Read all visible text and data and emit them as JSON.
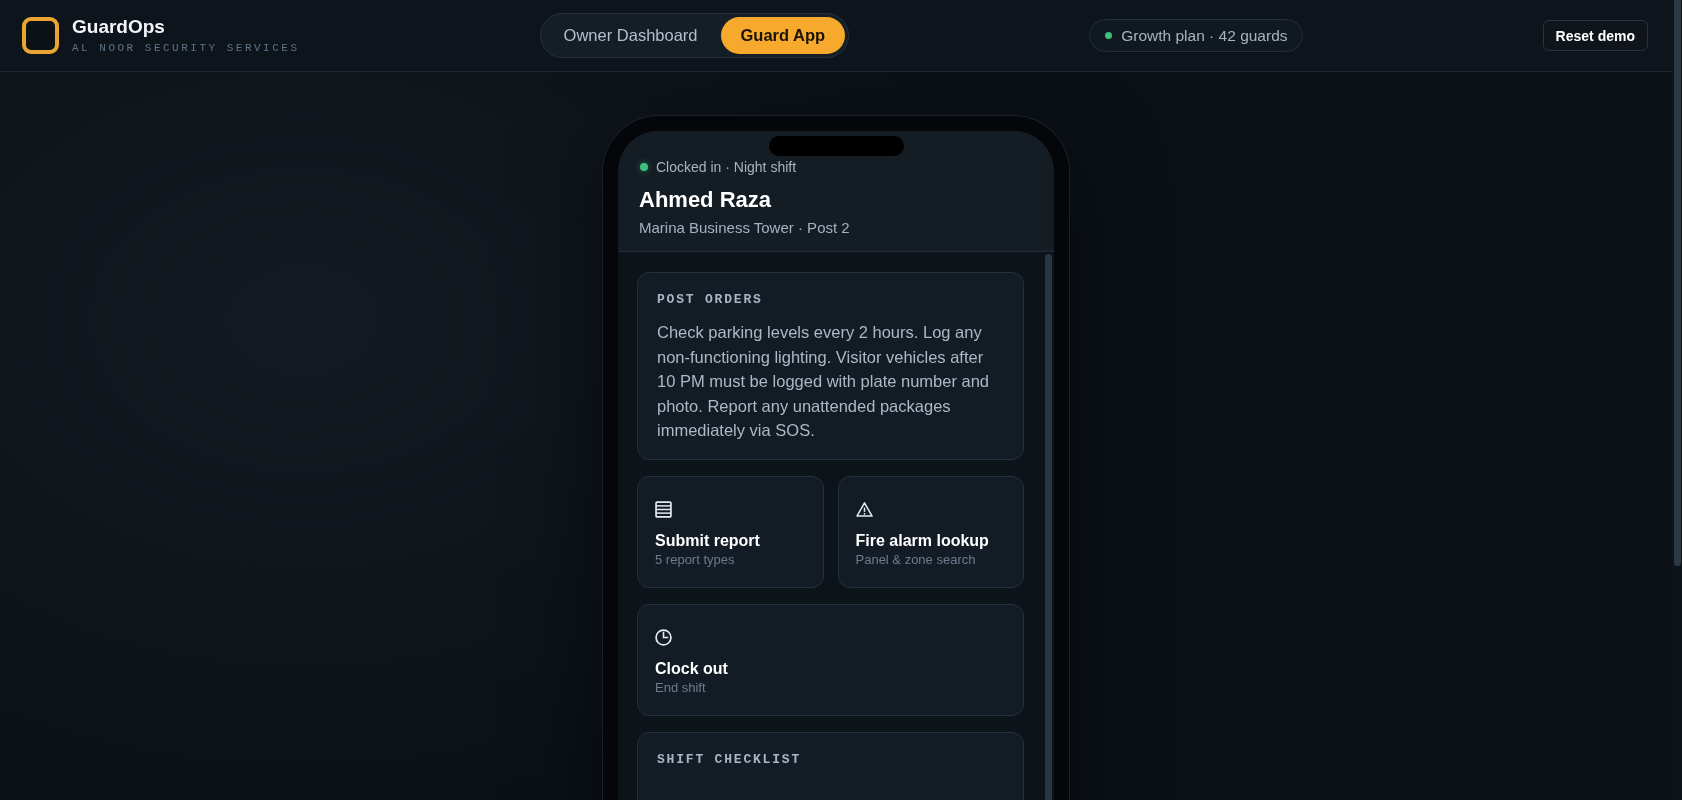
{
  "header": {
    "brand": {
      "name": "GuardOps",
      "tagline": "AL NOOR SECURITY SERVICES"
    },
    "view_switch": [
      {
        "label": "Owner Dashboard",
        "selected": false
      },
      {
        "label": "Guard App",
        "selected": true
      }
    ],
    "plan_badge": {
      "text": "Growth plan · 42 guards"
    },
    "reset_button": "Reset demo"
  },
  "guard_app": {
    "status": {
      "text": "Clocked in · Night shift",
      "clocked_in": true
    },
    "guard_name": "Ahmed Raza",
    "location": "Marina Business Tower · Post 2",
    "post_orders": {
      "title": "POST ORDERS",
      "text": "Check parking levels every 2 hours. Log any non-functioning lighting. Visitor vehicles after 10 PM must be logged with plate number and photo. Report any unattended packages immediately via SOS."
    },
    "actions": [
      {
        "kind": "report",
        "title": "Submit report",
        "subtitle": "5 report types"
      },
      {
        "kind": "alarm",
        "title": "Fire alarm lookup",
        "subtitle": "Panel & zone search"
      },
      {
        "kind": "clock",
        "title": "Clock out",
        "subtitle": "End shift"
      }
    ],
    "checklist": {
      "title": "SHIFT CHECKLIST"
    }
  }
}
